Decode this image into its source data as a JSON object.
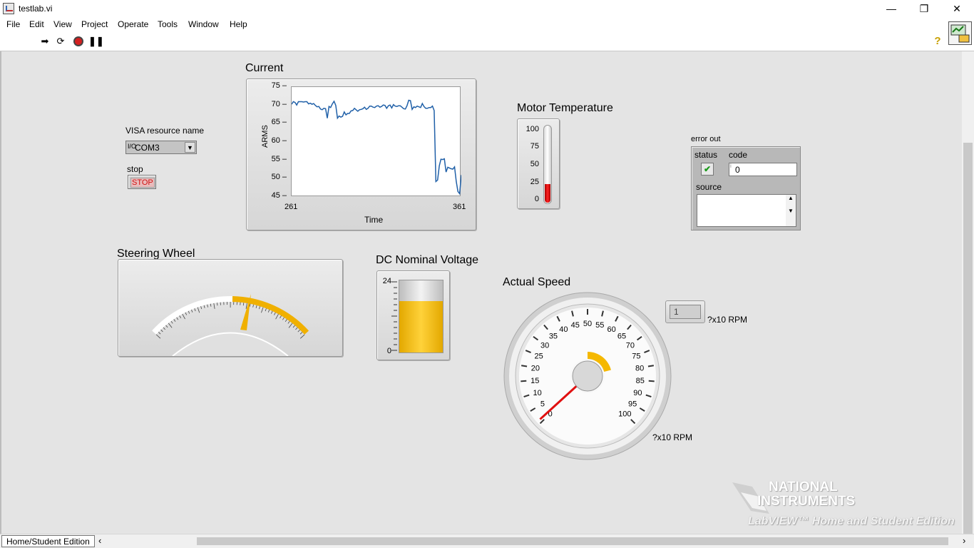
{
  "window": {
    "title": "testlab.vi"
  },
  "menu": [
    "File",
    "Edit",
    "View",
    "Project",
    "Operate",
    "Tools",
    "Window",
    "Help"
  ],
  "visa": {
    "label": "VISA resource name",
    "value": "COM3"
  },
  "stop": {
    "label": "stop",
    "button": "STOP"
  },
  "current": {
    "title": "Current",
    "ylabel": "ARMS",
    "xlabel": "Time",
    "yticks": [
      "75",
      "70",
      "65",
      "60",
      "55",
      "50",
      "45"
    ],
    "xticks": [
      "261",
      "361"
    ]
  },
  "chart_data": {
    "type": "line",
    "title": "Current",
    "xlabel": "Time",
    "ylabel": "ARMS",
    "xlim": [
      261,
      361
    ],
    "ylim": [
      45,
      75
    ],
    "series": [
      {
        "x": [
          261,
          262,
          263,
          264,
          265,
          266,
          267,
          268,
          269,
          270,
          271,
          272,
          273,
          274,
          275,
          276,
          277,
          278,
          279,
          280,
          281,
          282,
          283,
          284,
          285,
          286,
          287,
          288,
          289,
          290,
          291,
          292,
          293,
          294,
          295,
          296,
          297,
          298,
          299,
          300,
          301,
          302,
          303,
          304,
          305,
          306,
          307,
          308,
          309,
          310,
          311,
          312,
          313,
          314,
          315,
          316,
          317,
          318,
          319,
          320,
          321,
          322,
          323,
          324,
          325,
          326,
          327,
          328,
          329,
          330,
          331,
          332,
          333,
          334,
          335,
          336,
          337,
          338,
          339,
          340,
          341,
          342,
          343,
          344,
          345,
          346,
          347,
          348,
          349,
          350,
          351,
          352,
          353,
          354,
          355,
          356,
          357,
          358,
          359,
          360,
          361
        ],
        "y": [
          70.3,
          71,
          70.8,
          70.1,
          71,
          71,
          71,
          70.9,
          71,
          71,
          70.4,
          70.6,
          70.3,
          70.5,
          70,
          69.6,
          69.7,
          69,
          68.8,
          69.2,
          69.1,
          66.5,
          69.7,
          69.4,
          70.4,
          71.1,
          70,
          66.5,
          67.1,
          66.8,
          67,
          68.2,
          67.4,
          67.8,
          67.8,
          68.5,
          68.6,
          69.2,
          68.8,
          68.4,
          68.8,
          68.9,
          69.1,
          69.5,
          68.9,
          69.2,
          69.8,
          69.8,
          69.5,
          69.4,
          69.8,
          69.9,
          69.5,
          69.7,
          70.1,
          70,
          69.2,
          69.9,
          70.1,
          69.3,
          70.2,
          69.8,
          69.7,
          69.9,
          69.9,
          69.5,
          69.1,
          69,
          69.9,
          71.4,
          71.3,
          68.9,
          69.6,
          69.4,
          69.8,
          69.6,
          69.4,
          70.5,
          69.7,
          69.2,
          69.2,
          69.4,
          69.4,
          69.8,
          68.6,
          49.2,
          49.6,
          53.5,
          55.3,
          55.2,
          55.4,
          51.8,
          53.1,
          52.9,
          52.7,
          52.6,
          53.2,
          49.2,
          46.5,
          45.9,
          51
        ]
      }
    ],
    "grid": false
  },
  "motor": {
    "title": "Motor Temperature",
    "ticks": [
      "100",
      "75",
      "50",
      "25",
      "0"
    ],
    "value": 25
  },
  "error": {
    "label": "error out",
    "status_label": "status",
    "code_label": "code",
    "code_value": "0",
    "source_label": "source",
    "source_value": ""
  },
  "steering": {
    "title": "Steering Wheel"
  },
  "dc": {
    "title": "DC Nominal Voltage",
    "ticks": [
      "24",
      "0"
    ],
    "value": 17
  },
  "speed": {
    "title": "Actual Speed",
    "ticks": [
      "0",
      "5",
      "10",
      "15",
      "20",
      "25",
      "30",
      "35",
      "40",
      "45",
      "50",
      "55",
      "60",
      "65",
      "70",
      "75",
      "80",
      "85",
      "90",
      "95",
      "100"
    ],
    "units": "?x10 RPM",
    "indicator_value": "1",
    "indicator_units": "?x10 RPM",
    "needle": 1
  },
  "branding": {
    "line1": "NATIONAL",
    "line2": "INSTRUMENTS",
    "line3": "LabVIEW™ Home and Student Edition"
  },
  "status_bar": {
    "edition": "Home/Student Edition"
  }
}
